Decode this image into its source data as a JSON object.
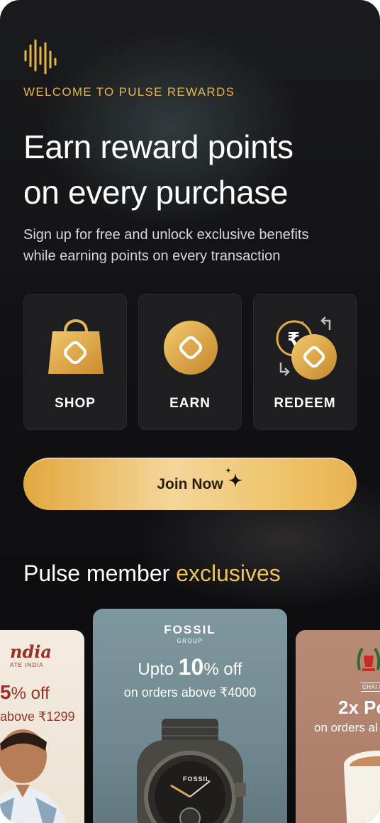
{
  "app": {
    "logo_icon": "waveform-icon",
    "eyebrow": "WELCOME TO PULSE REWARDS",
    "headline_line1": "Earn reward points",
    "headline_line2": "on every purchase",
    "subline_line1": "Sign up for free and unlock exclusive benefits",
    "subline_line2": "while earning points on every transaction",
    "accent_color": "#e8b54a"
  },
  "tiles": [
    {
      "label": "SHOP",
      "icon": "shopping-bag-icon"
    },
    {
      "label": "EARN",
      "icon": "coin-icon"
    },
    {
      "label": "REDEEM",
      "icon": "redeem-exchange-icon"
    }
  ],
  "cta": {
    "label": "Join Now",
    "icon": "sparkle-icon"
  },
  "section": {
    "title_plain": "Pulse member ",
    "title_accent": "exclusives"
  },
  "offers": [
    {
      "brand": "ndia",
      "brand_sub": "ATE INDIA",
      "headline_num": "5",
      "headline_suffix": "% off",
      "condition": "above ₹1299"
    },
    {
      "brand": "FOSSIL",
      "brand_sub": "GROUP",
      "headline_pre": "Upto ",
      "headline_num": "10",
      "headline_suffix": "% off",
      "condition": "on orders above ₹4000",
      "product_text": "FOSSIL"
    },
    {
      "brand": "CHAI P",
      "headline": "2x Po",
      "condition": "on orders al"
    }
  ]
}
